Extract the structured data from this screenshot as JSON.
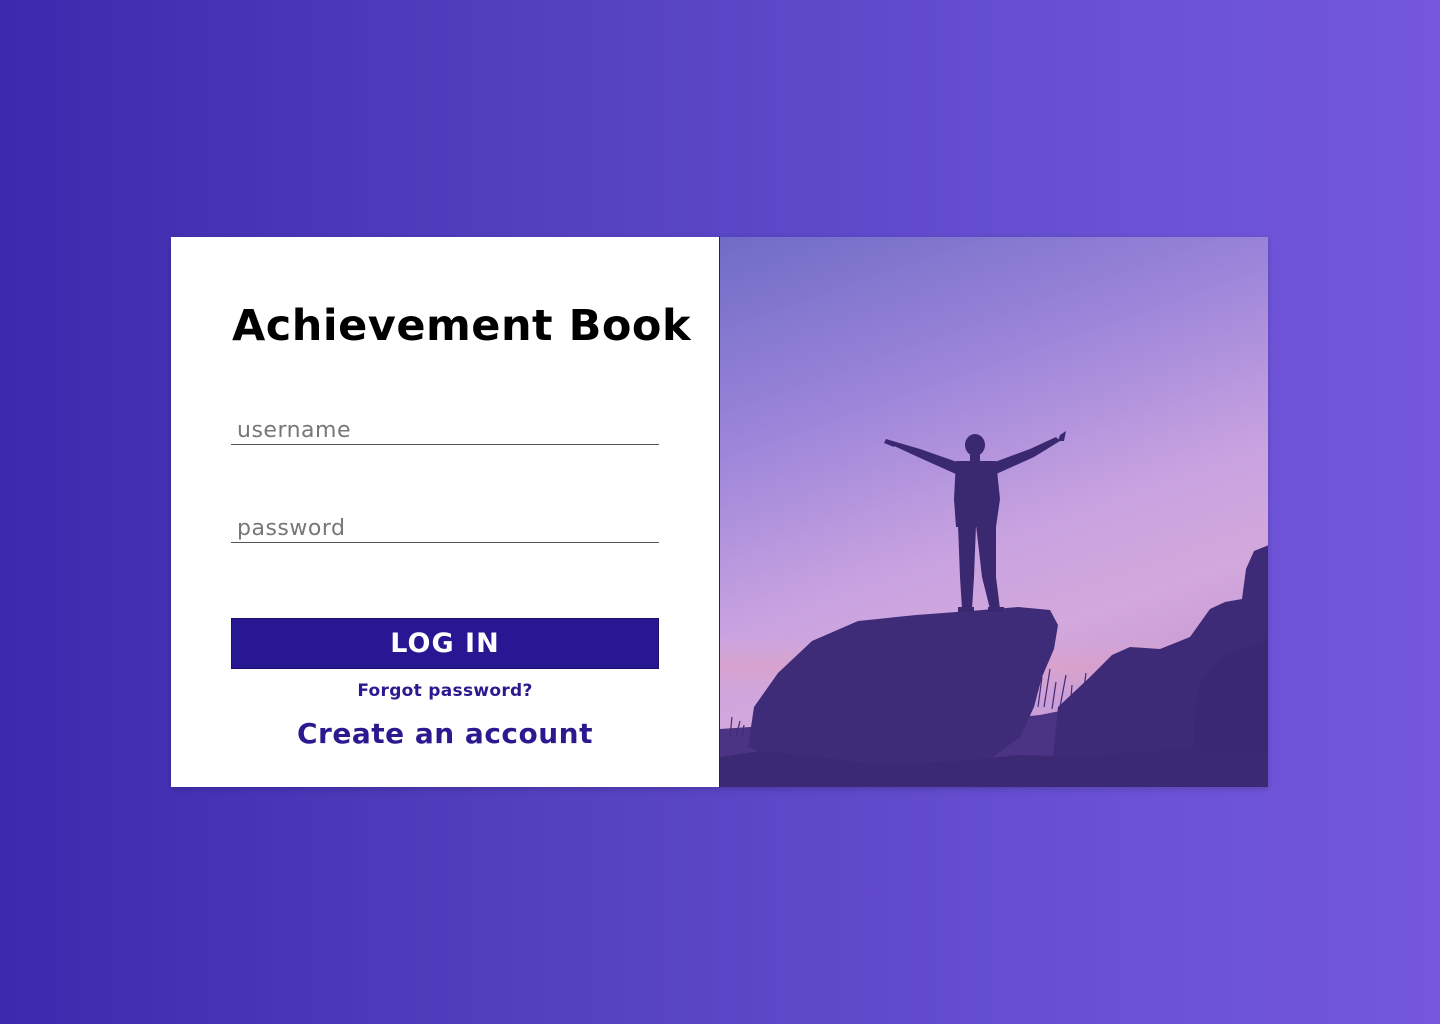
{
  "app": {
    "title": "Achievement Book"
  },
  "login_form": {
    "username_placeholder": "username",
    "password_placeholder": "password",
    "login_label": "LOG IN",
    "forgot_password_label": "Forgot password?",
    "create_account_label": "Create an account"
  },
  "hero_image": {
    "description_icon": "person-on-rock-silhouette",
    "colors": {
      "sky_top": "#6f6cc6",
      "sky_bottom": "#d2a8e0",
      "silhouette": "#3f2c78"
    }
  },
  "colors": {
    "background_start": "#3c2aae",
    "background_end": "#7457dc",
    "accent": "#271793",
    "link": "#2b1a8f"
  }
}
